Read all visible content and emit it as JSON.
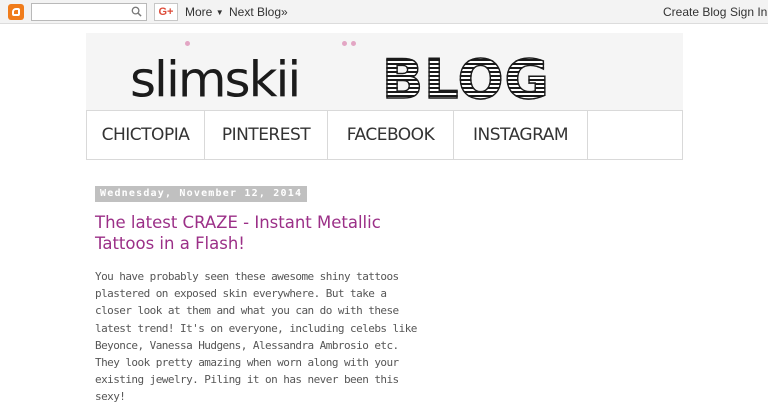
{
  "navbar": {
    "more_label": "More",
    "next_blog_label": "Next Blog»",
    "create_blog_label": "Create Blog",
    "sign_in_label": "Sign In",
    "gplus_label": "G+",
    "search_value": ""
  },
  "header": {
    "brand_left": "slimskii",
    "brand_right": "BLOG",
    "accent_color": "#e3a6c4"
  },
  "menu": {
    "items": [
      {
        "label": "CHICTOPIA"
      },
      {
        "label": "PINTEREST"
      },
      {
        "label": "FACEBOOK"
      },
      {
        "label": "INSTAGRAM"
      }
    ]
  },
  "post": {
    "date": "Wednesday, November 12, 2014",
    "title": "The latest CRAZE - Instant Metallic Tattoos in a Flash!",
    "body": "You have probably seen these awesome shiny tattoos plastered on exposed skin everywhere. But take a closer look at them and what you can do with these latest trend! It's on everyone, including celebs like Beyonce, Vanessa Hudgens, Alessandra Ambrosio etc. They look pretty amazing when worn along with your existing jewelry. Piling it on has never been this sexy!",
    "title_color": "#9b2f87"
  }
}
